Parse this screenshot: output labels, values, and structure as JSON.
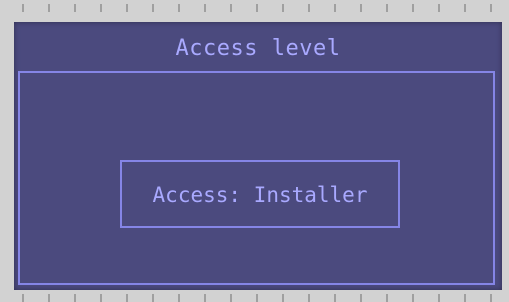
{
  "dialog": {
    "title": "Access level",
    "status_text": "Access: Installer"
  },
  "colors": {
    "background": "#4b4a7e",
    "accent": "#8585e6",
    "text": "#a9a9ff"
  }
}
